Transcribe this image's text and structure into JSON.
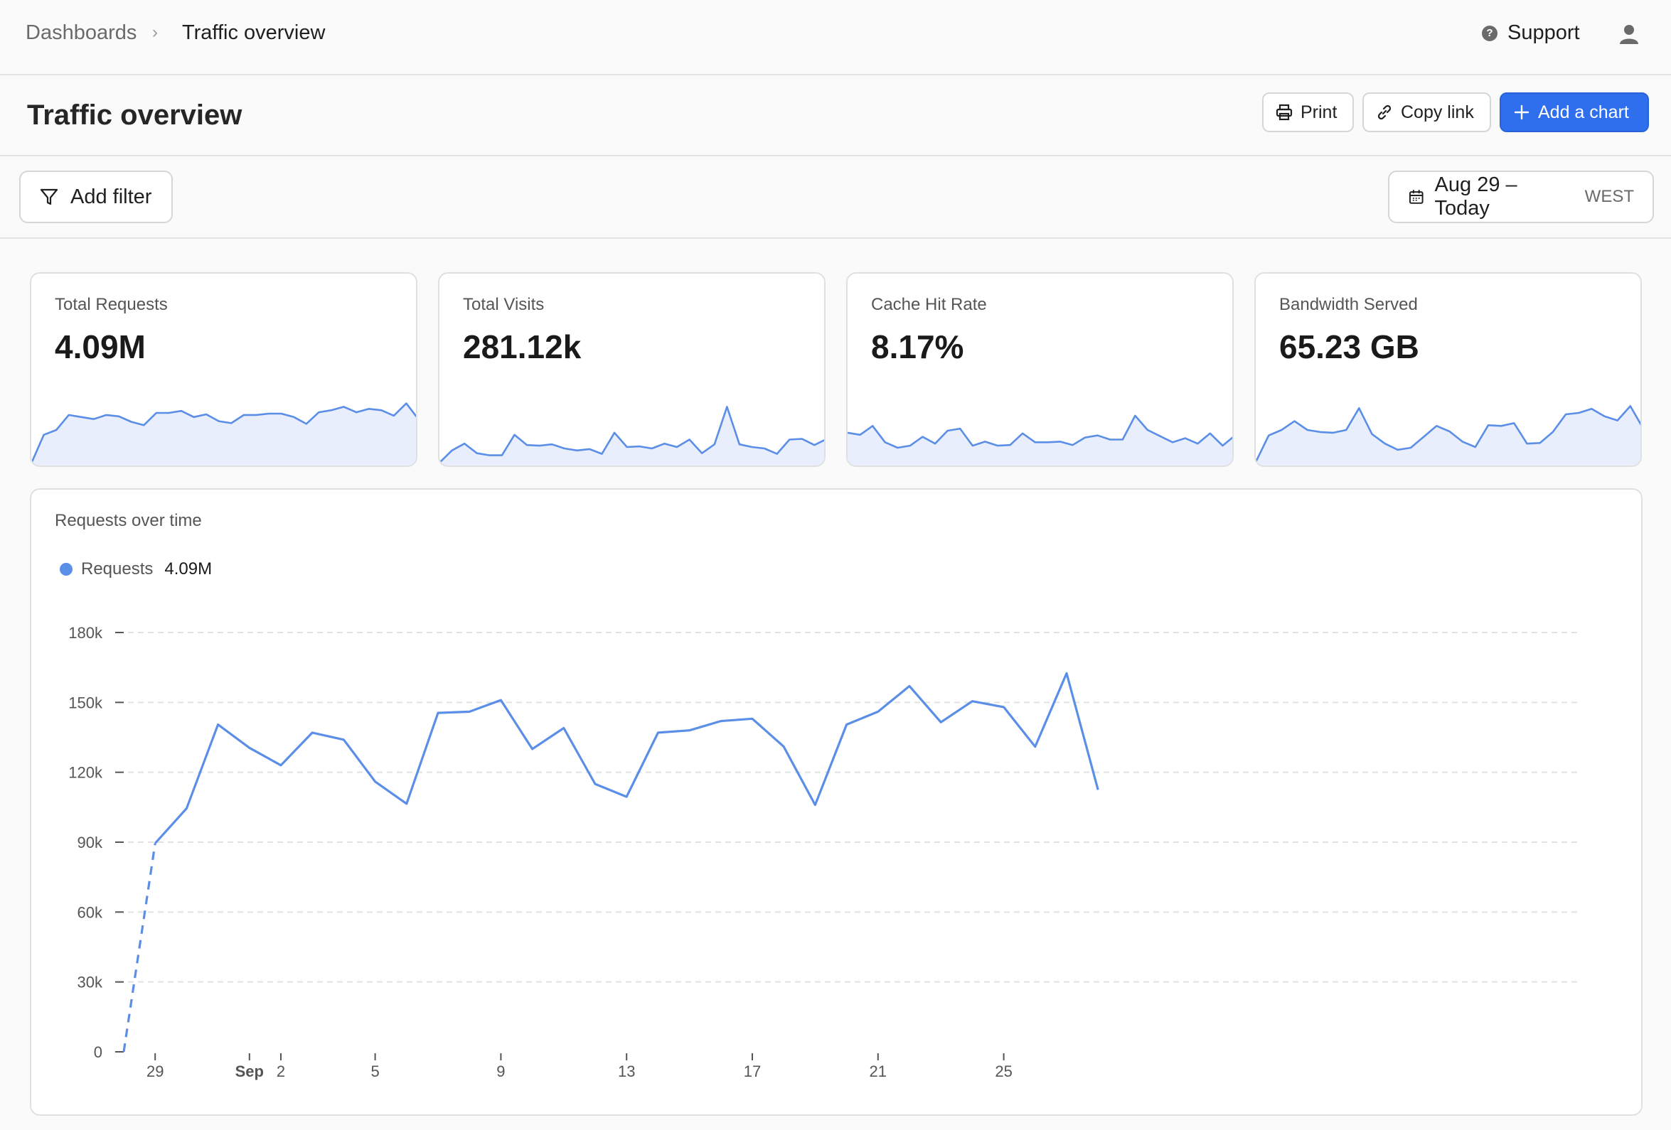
{
  "breadcrumb": {
    "root": "Dashboards",
    "separator": "›",
    "current": "Traffic overview"
  },
  "topbar": {
    "support_label": "Support",
    "support_icon": "help-circle-icon",
    "user_icon": "user-icon"
  },
  "header": {
    "title": "Traffic overview",
    "buttons": {
      "print": "Print",
      "copy_link": "Copy link",
      "add_chart": "Add a chart"
    }
  },
  "filters": {
    "add_filter": "Add filter",
    "date_range": "Aug 29 – Today",
    "timezone": "WEST"
  },
  "colors": {
    "accent": "#2f6fed",
    "series": "#5b8ee6",
    "spark_fill": "#e8eefc"
  },
  "cards": [
    {
      "label": "Total Requests",
      "value": "4.09M",
      "spark": [
        2,
        44,
        51,
        73,
        70,
        67,
        73,
        71,
        63,
        58,
        76,
        76,
        79,
        70,
        74,
        64,
        61,
        73,
        73,
        75,
        75,
        70,
        60,
        77,
        80,
        85,
        77,
        82,
        80,
        72,
        90,
        66
      ]
    },
    {
      "label": "Total Visits",
      "value": "281.12k",
      "spark": [
        3,
        21,
        31,
        17,
        14,
        14,
        44,
        29,
        28,
        30,
        24,
        21,
        23,
        16,
        47,
        26,
        27,
        24,
        31,
        26,
        37,
        17,
        30,
        85,
        30,
        26,
        24,
        16,
        37,
        38,
        29,
        38
      ]
    },
    {
      "label": "Cache Hit Rate",
      "value": "8.17%",
      "spark": [
        47,
        44,
        57,
        33,
        25,
        28,
        41,
        31,
        50,
        53,
        28,
        34,
        28,
        29,
        46,
        33,
        33,
        34,
        29,
        40,
        43,
        37,
        37,
        72,
        51,
        42,
        33,
        39,
        31,
        46,
        28,
        43
      ]
    },
    {
      "label": "Bandwidth Served",
      "value": "65.23 GB",
      "spark": [
        4,
        43,
        51,
        64,
        51,
        48,
        47,
        51,
        83,
        45,
        31,
        22,
        25,
        41,
        57,
        49,
        34,
        26,
        58,
        57,
        61,
        31,
        32,
        48,
        74,
        76,
        82,
        71,
        65,
        86,
        53
      ]
    }
  ],
  "chart_data": {
    "type": "line",
    "title": "Requests over time",
    "legend": {
      "name": "Requests",
      "value": "4.09M"
    },
    "y_ticks": [
      "0",
      "30k",
      "60k",
      "90k",
      "120k",
      "150k",
      "180k"
    ],
    "ylim": [
      0,
      180000
    ],
    "x_tick_labels": [
      {
        "day": 1,
        "label": "29"
      },
      {
        "day": 4,
        "label": "Sep",
        "bold": true
      },
      {
        "day": 5,
        "label": "2"
      },
      {
        "day": 8,
        "label": "5"
      },
      {
        "day": 12,
        "label": "9"
      },
      {
        "day": 16,
        "label": "13"
      },
      {
        "day": 20,
        "label": "17"
      },
      {
        "day": 24,
        "label": "21"
      },
      {
        "day": 28,
        "label": "25"
      }
    ],
    "grid": "horizontal dashed",
    "series": [
      {
        "name": "Requests",
        "partial_start": true,
        "x": [
          "Aug 28",
          "Aug 29",
          "Aug 30",
          "Aug 31",
          "Sep 1",
          "Sep 2",
          "Sep 3",
          "Sep 4",
          "Sep 5",
          "Sep 6",
          "Sep 7",
          "Sep 8",
          "Sep 9",
          "Sep 10",
          "Sep 11",
          "Sep 12",
          "Sep 13",
          "Sep 14",
          "Sep 15",
          "Sep 16",
          "Sep 17",
          "Sep 18",
          "Sep 19",
          "Sep 20",
          "Sep 21",
          "Sep 22",
          "Sep 23",
          "Sep 24",
          "Sep 25",
          "Sep 26",
          "Sep 27",
          "Sep 28"
        ],
        "values": [
          0,
          89500,
          104500,
          140500,
          130500,
          123000,
          137000,
          134000,
          116000,
          106500,
          145500,
          146000,
          151000,
          130000,
          139000,
          115000,
          109500,
          137000,
          138000,
          142000,
          143000,
          131000,
          106000,
          140500,
          146000,
          157000,
          141500,
          150500,
          148000,
          131000,
          162500,
          112500
        ]
      }
    ]
  }
}
